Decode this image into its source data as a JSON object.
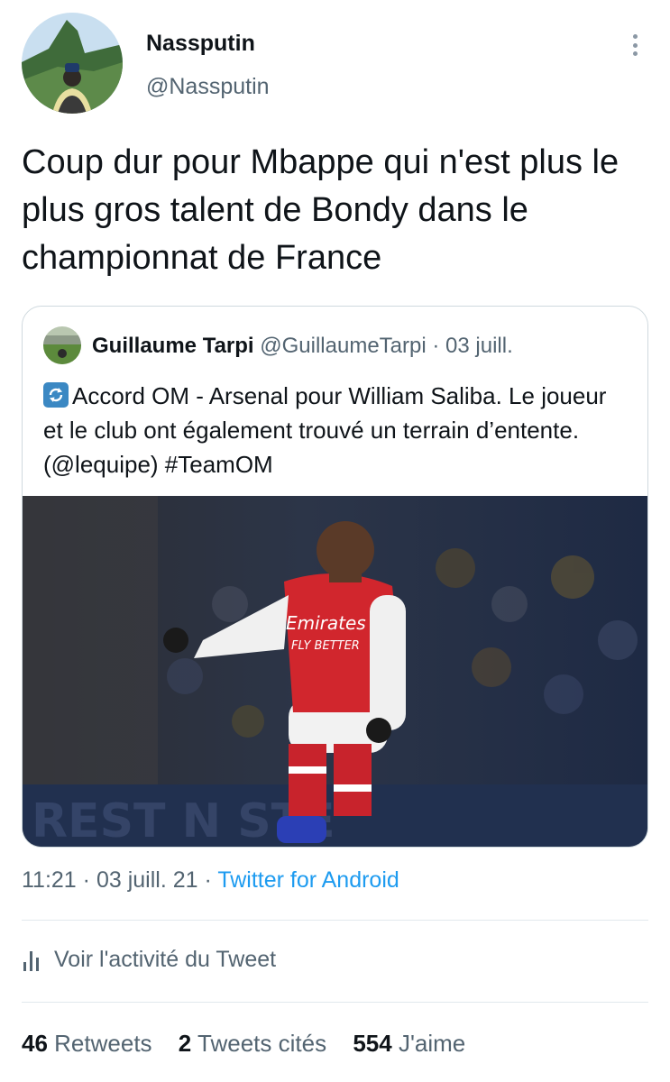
{
  "tweet": {
    "author_name": "Nassputin",
    "author_handle": "@Nassputin",
    "text": "Coup dur pour Mbappe qui n'est plus le plus gros talent de Bondy dans le championnat de France",
    "time": "11:21",
    "date": "03 juill. 21",
    "separator": "·",
    "source": "Twitter for Android"
  },
  "quoted": {
    "author_name": "Guillaume Tarpi",
    "author_handle": "@GuillaumeTarpi",
    "separator": "·",
    "date": "03 juill.",
    "icon": "sync-icon",
    "text": "Accord OM - Arsenal pour William Saliba. Le joueur et le club ont également trouvé un terrain d’entente. (@lequipe) #TeamOM",
    "image": {
      "icon": "photo-footballer",
      "jersey_text_1": "Emirates",
      "jersey_text_2": "FLY BETTER",
      "board_text": "REST  N  STE"
    }
  },
  "activity": {
    "label": "Voir l'activité du Tweet",
    "icon": "analytics-icon"
  },
  "stats": {
    "retweets_count": "46",
    "retweets_label": "Retweets",
    "quotes_count": "2",
    "quotes_label": "Tweets cités",
    "likes_count": "554",
    "likes_label": "J'aime"
  },
  "colors": {
    "link": "#1d9bf0",
    "secondary_text": "#536471",
    "border": "#cfd9de"
  }
}
